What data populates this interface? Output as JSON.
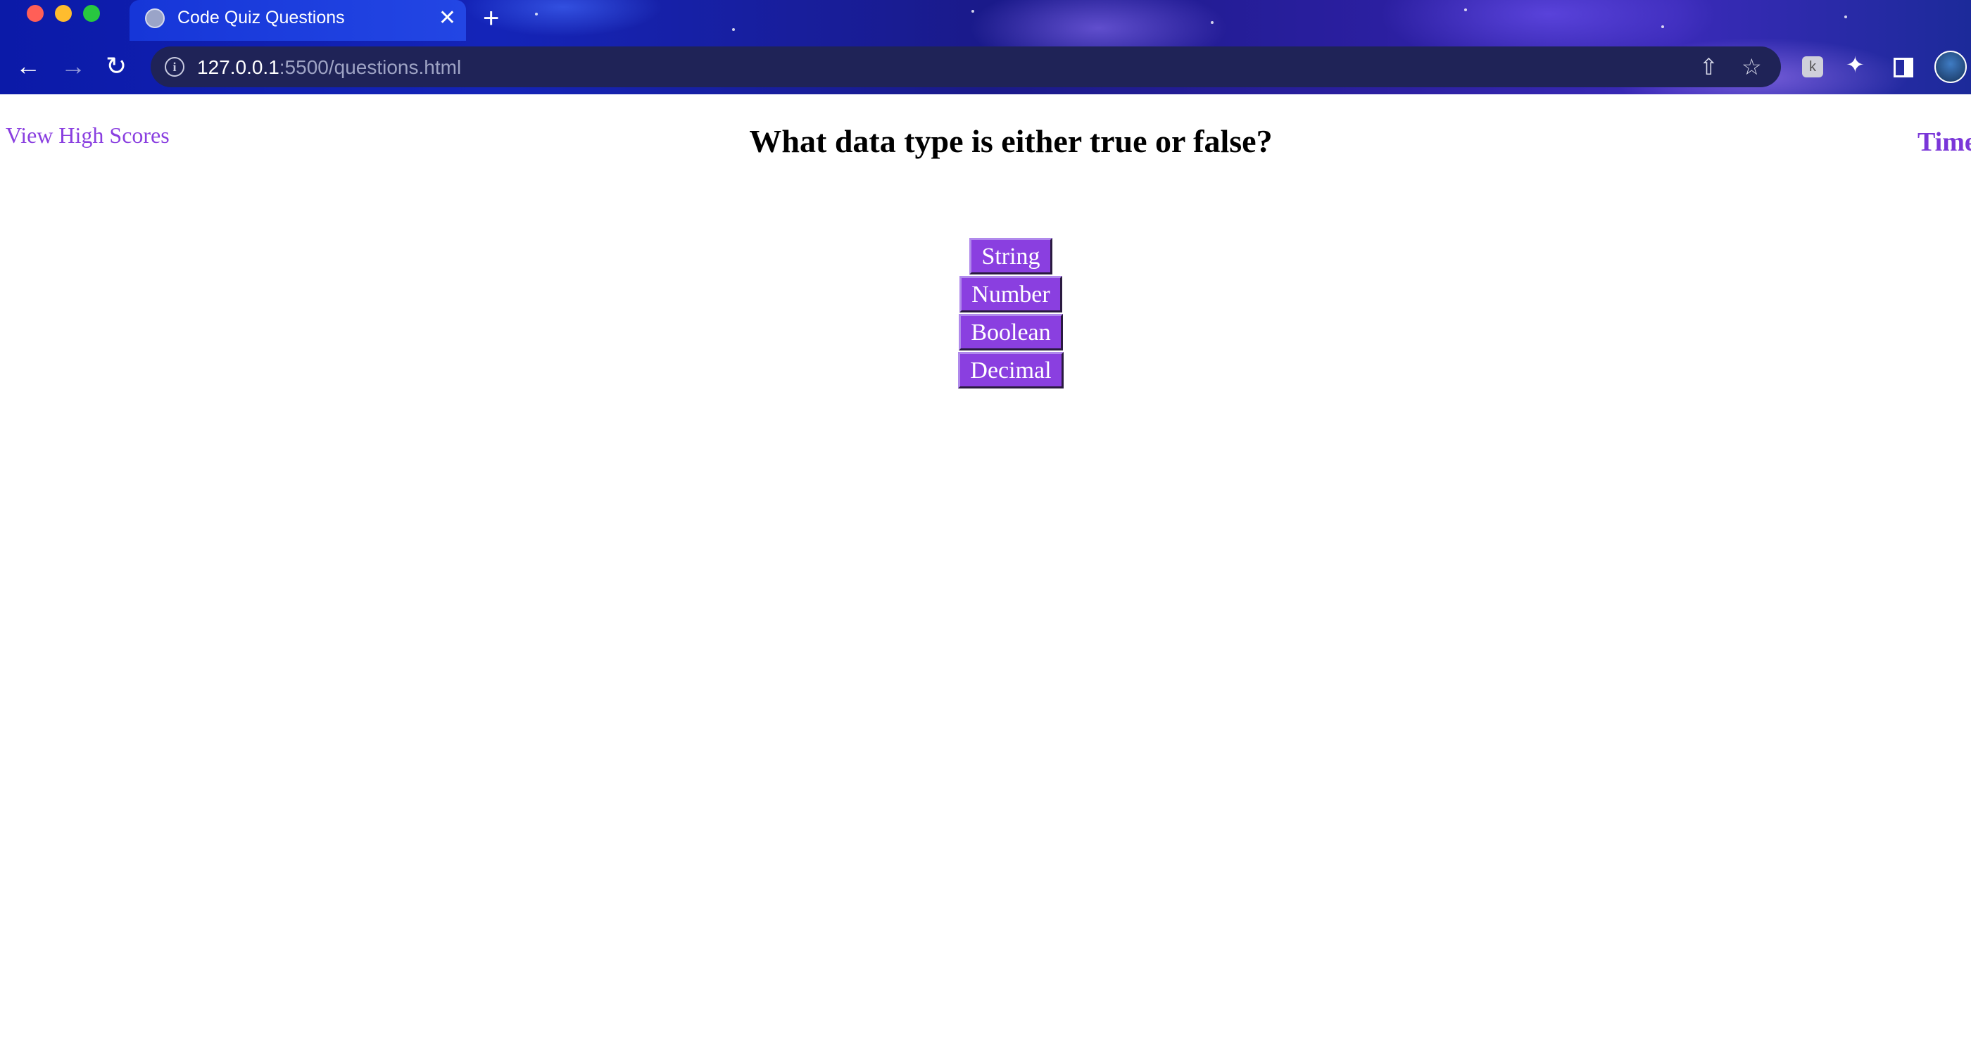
{
  "browser": {
    "tab_title": "Code Quiz Questions",
    "tab_close": "✕",
    "new_tab": "+",
    "url_host": "127.0.0.1",
    "url_rest": ":5500/questions.html"
  },
  "page": {
    "high_scores_link": "View High Scores",
    "timer_label": "Time",
    "question": "What data type is either true or false?",
    "answers": [
      "String",
      "Number",
      "Boolean",
      "Decimal"
    ]
  },
  "colors": {
    "accent": "#8a3fe0",
    "chrome_gradient_start": "#0b1aa8",
    "chrome_gradient_end": "#3a2ab8"
  },
  "icons": {
    "back": "arrow-left-icon",
    "forward": "arrow-right-icon",
    "reload": "reload-icon",
    "info": "info-icon",
    "share": "share-icon",
    "bookmark": "star-icon",
    "extension": "puzzle-icon",
    "side_panel": "side-panel-icon"
  }
}
